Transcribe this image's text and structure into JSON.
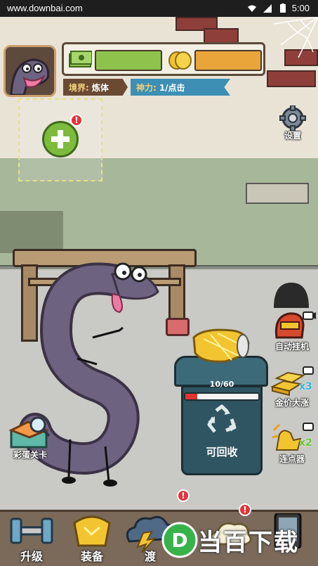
{
  "status_bar": {
    "site": "www.downbai.com",
    "time": "5:00"
  },
  "hud": {
    "realm_label": "境界:",
    "realm_value": "炼体",
    "power_label": "神力:",
    "power_value": "1/点击",
    "cash_icon": "cash-stack-icon",
    "coin_icon": "gold-coins-icon",
    "add_slot_alert": "!"
  },
  "settings": {
    "label": "设置"
  },
  "bin": {
    "count": "10/60",
    "progress": 0.1667,
    "label": "可回收"
  },
  "right_actions": [
    {
      "label": "自动挂机",
      "icon": "robot-head-icon",
      "badge": ""
    },
    {
      "label": "金价大涨",
      "icon": "gold-bars-icon",
      "badge": "x3"
    },
    {
      "label": "连点器",
      "icon": "tap-hand-icon",
      "badge": "x2"
    }
  ],
  "left_action": {
    "label": "彩蛋关卡",
    "icon": "magnifier-box-icon"
  },
  "bottom_nav": [
    {
      "label": "升级",
      "icon": "dumbbell-icon"
    },
    {
      "label": "装备",
      "icon": "gold-armor-icon"
    },
    {
      "label": "渡",
      "icon": "storm-cloud-icon",
      "alert": "!"
    },
    {
      "label": "",
      "icon": "cloud-item-icon",
      "alert": "!"
    },
    {
      "label": "",
      "icon": "phone-icon"
    }
  ],
  "watermark": {
    "text": "当百下载",
    "logo_letter": "D"
  },
  "colors": {
    "hud_green": "#8ec24d",
    "hud_orange": "#e9a53a",
    "realm_tag": "#6b4a33",
    "power_tag": "#3e8fb4",
    "bin_fill": "#e3342f",
    "bin_body": "#2f5562"
  }
}
